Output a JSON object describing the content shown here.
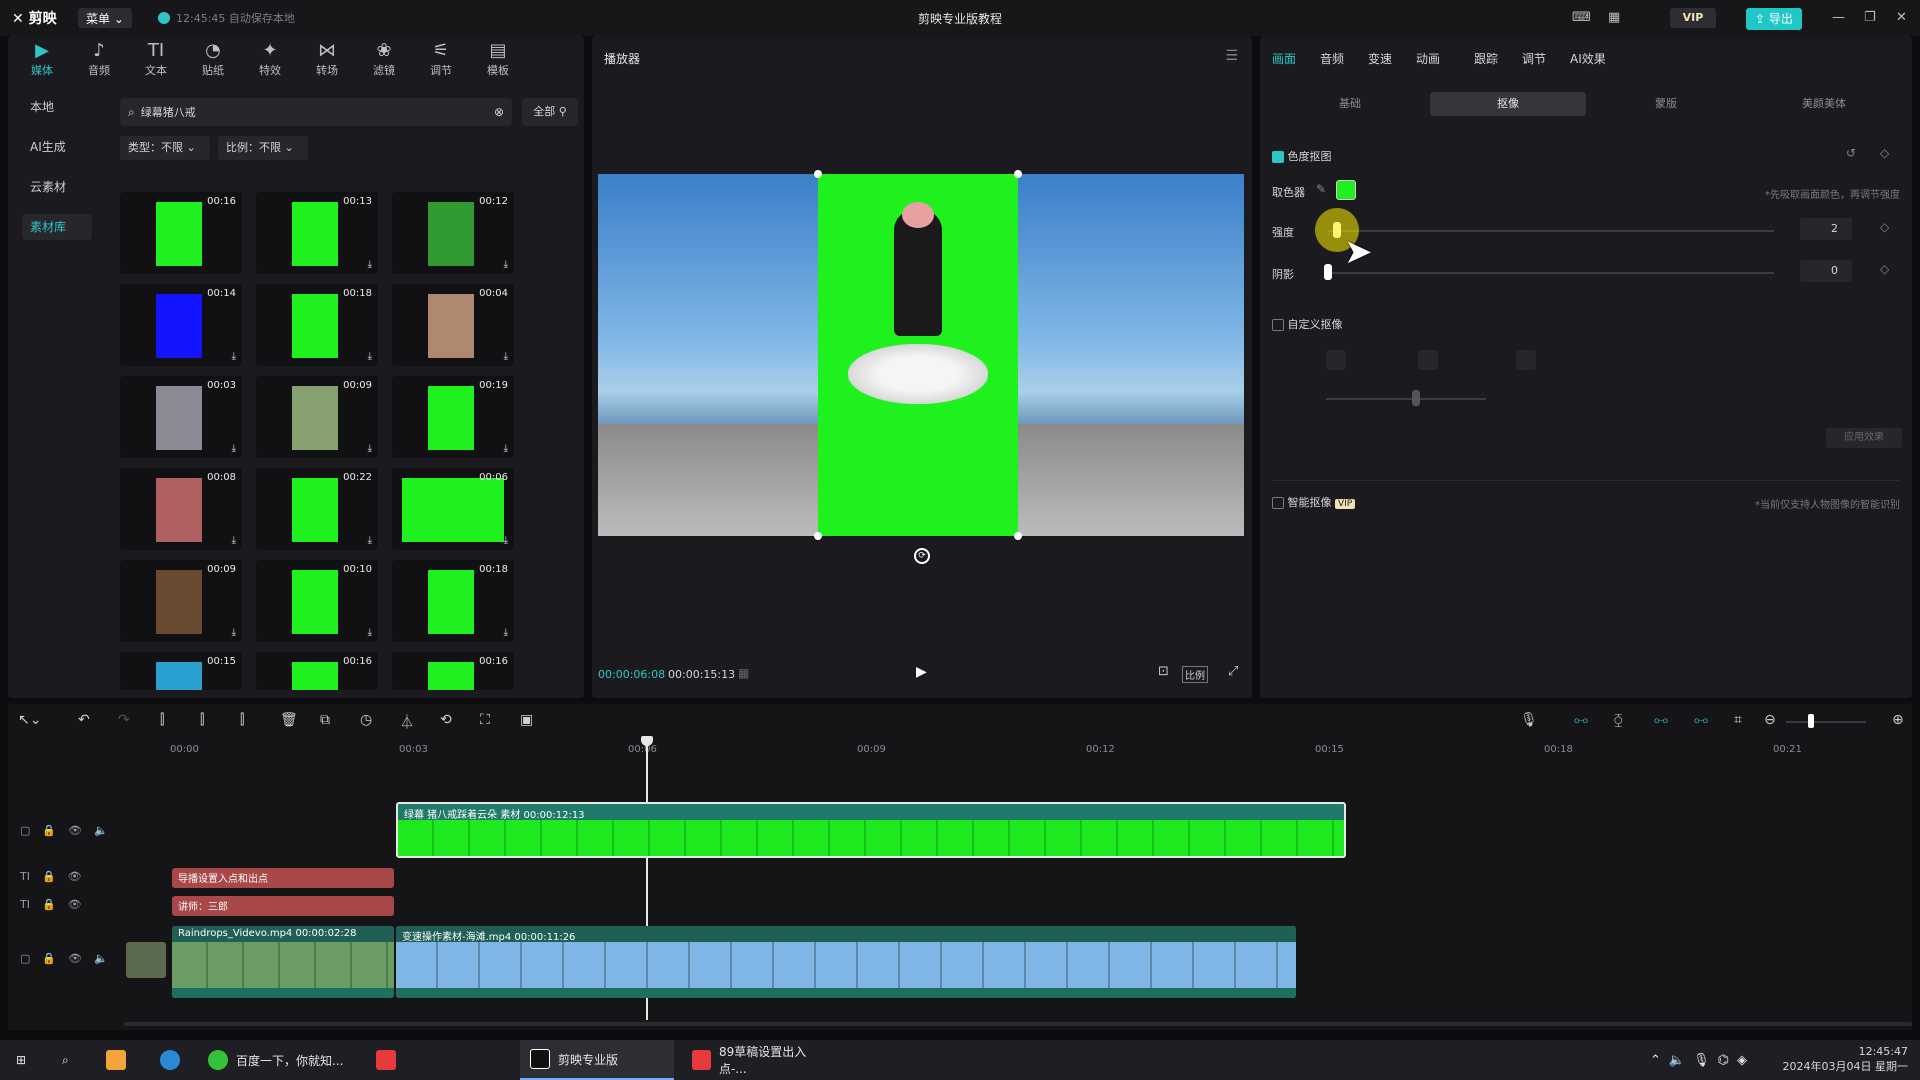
{
  "titlebar": {
    "logo": "剪映",
    "menu_label": "菜单",
    "save_status": "12:45:45 自动保存本地",
    "window_title": "剪映专业版教程",
    "vip_label": "VIP",
    "export_label": "导出"
  },
  "media_toolbar": [
    {
      "label": "媒体",
      "icon": "▶"
    },
    {
      "label": "音频",
      "icon": "♪"
    },
    {
      "label": "文本",
      "icon": "TI"
    },
    {
      "label": "贴纸",
      "icon": "◔"
    },
    {
      "label": "特效",
      "icon": "✦"
    },
    {
      "label": "转场",
      "icon": "⋈"
    },
    {
      "label": "滤镜",
      "icon": "❀"
    },
    {
      "label": "调节",
      "icon": "⚟"
    },
    {
      "label": "模板",
      "icon": "▤"
    }
  ],
  "side_nav": [
    {
      "label": "本地"
    },
    {
      "label": "AI生成"
    },
    {
      "label": "云素材"
    },
    {
      "label": "素材库"
    }
  ],
  "search": {
    "value": "绿幕猪八戒"
  },
  "filter_all": "全部",
  "filters": {
    "type": "类型：不限",
    "ratio": "比例：不限"
  },
  "thumbnails": [
    {
      "dur": "00:16",
      "color": "#1ff11f"
    },
    {
      "dur": "00:13",
      "color": "#1ff11f"
    },
    {
      "dur": "00:12",
      "color": "#2f9b32"
    },
    {
      "dur": "00:14",
      "color": "#1414ff"
    },
    {
      "dur": "00:18",
      "color": "#1ff11f"
    },
    {
      "dur": "00:04",
      "color": "#b08870"
    },
    {
      "dur": "00:03",
      "color": "#8a8a95"
    },
    {
      "dur": "00:09",
      "color": "#86a070"
    },
    {
      "dur": "00:19",
      "color": "#1ff11f"
    },
    {
      "dur": "00:08",
      "color": "#b06060"
    },
    {
      "dur": "00:22",
      "color": "#1ff11f"
    },
    {
      "dur": "00:06",
      "color": "#1ff11f"
    },
    {
      "dur": "00:09",
      "color": "#6a4a30"
    },
    {
      "dur": "00:10",
      "color": "#1ff11f"
    },
    {
      "dur": "00:18",
      "color": "#1ff11f"
    },
    {
      "dur": "00:15",
      "color": "#2aa0d0"
    },
    {
      "dur": "00:16",
      "color": "#1ff11f"
    },
    {
      "dur": "00:16",
      "color": "#1ff11f"
    }
  ],
  "player": {
    "label": "播放器",
    "current_time": "00:00:06:08",
    "total_time": "00:00:15:13",
    "ratio_label": "比例"
  },
  "right_tabs": [
    {
      "label": "画面"
    },
    {
      "label": "音频"
    },
    {
      "label": "变速"
    },
    {
      "label": "动画"
    },
    {
      "label": "跟踪"
    },
    {
      "label": "调节"
    },
    {
      "label": "AI效果"
    }
  ],
  "sub_tabs": [
    {
      "label": "基础"
    },
    {
      "label": "抠像"
    },
    {
      "label": "蒙版"
    },
    {
      "label": "美颜美体"
    }
  ],
  "chroma": {
    "title": "色度抠图",
    "picker_label": "取色器",
    "picker_hint": "*先吸取画面颜色，再调节强度",
    "picker_color": "#1ff11f",
    "strength_label": "强度",
    "strength_value": "2",
    "strength_fraction": 0.02,
    "shadow_label": "阴影",
    "shadow_value": "0",
    "shadow_fraction": 0.0
  },
  "custom_matting": {
    "title": "自定义抠像",
    "apply_label": "应用效果"
  },
  "smart_matting": {
    "title": "智能抠像",
    "badge": "VIP",
    "hint": "*当前仅支持人物图像的智能识别"
  },
  "timeline": {
    "ruler": [
      "00:00",
      "00:03",
      "00:06",
      "00:09",
      "00:12",
      "00:15",
      "00:18",
      "00:21"
    ],
    "clips": {
      "green_clip": "绿幕 猪八戒踩着云朵 素材  00:00:12:13",
      "text1": "导播设置入点和出点",
      "text2": "讲师：三郎",
      "rain_clip": "Raindrops_Videvo.mp4  00:00:02:28",
      "sky_clip": "变速操作素材-海滩.mp4  00:00:11:26"
    }
  },
  "taskbar": {
    "baidu": "百度一下，你就知...",
    "jianying": "剪映专业版",
    "app89": "89草稿设置出入点-...",
    "time": "12:45:47",
    "date": "2024年03月04日 星期一"
  }
}
